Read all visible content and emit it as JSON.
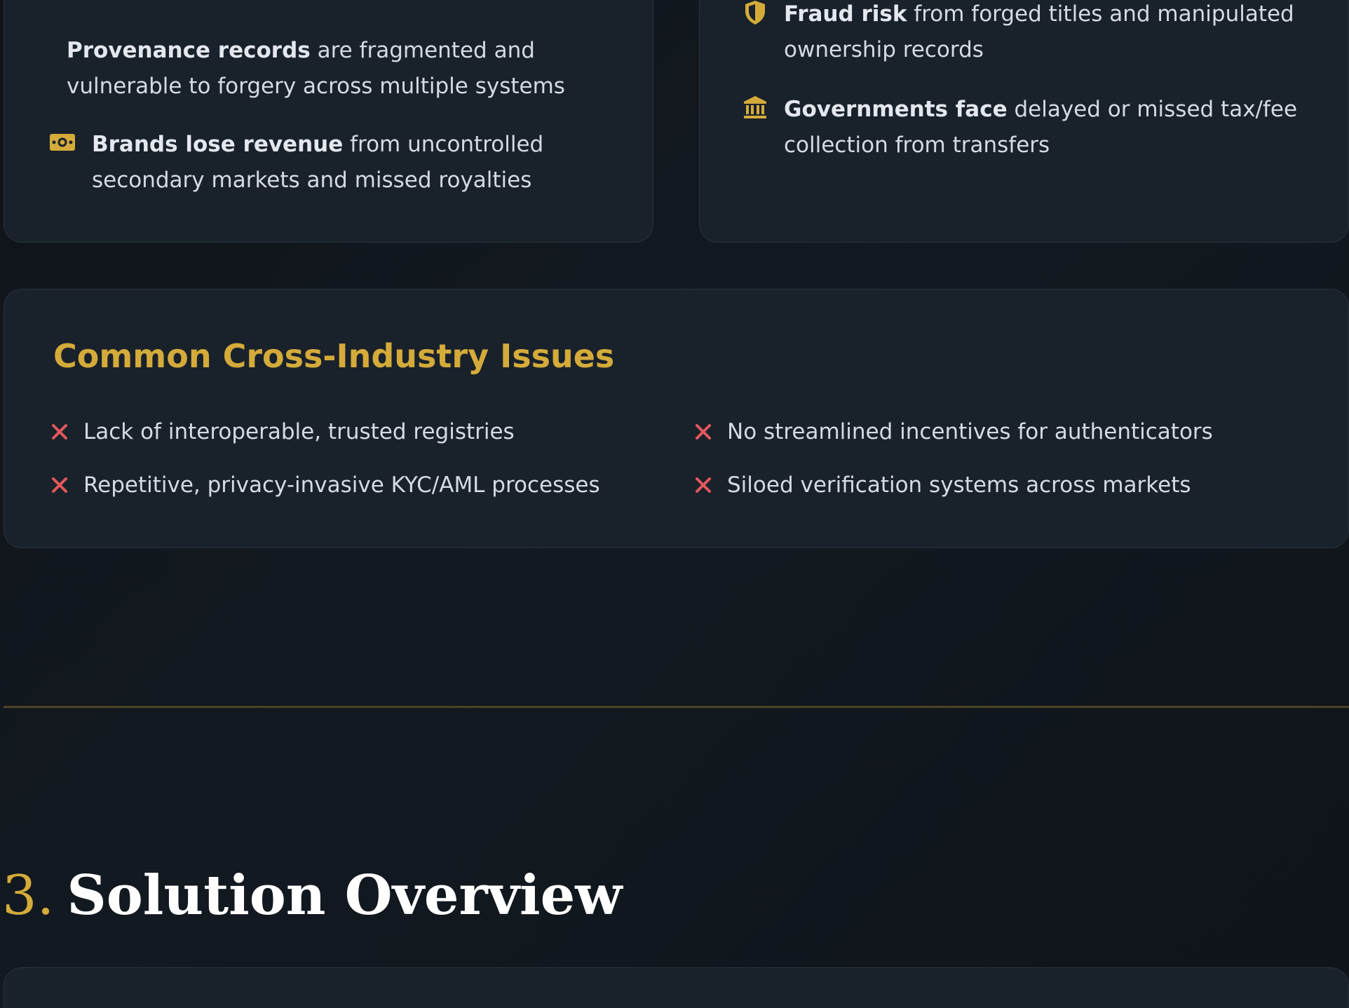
{
  "colors": {
    "accent": "#d4ab3a",
    "issue_x": "#e2585c",
    "card_bg": "#19212a",
    "page_bg": "#10141a"
  },
  "left_card": {
    "provenance": {
      "bold": "Provenance records",
      "line1_rest": " are fragmented and",
      "line2": "vulnerable to forgery across multiple systems"
    },
    "brands": {
      "icon": "money-bill-icon",
      "bold": "Brands lose revenue",
      "line1_rest": " from uncontrolled",
      "line2": "secondary markets and missed royalties"
    }
  },
  "right_card": {
    "fraud": {
      "icon": "shield-icon",
      "bold": "Fraud risk",
      "line1_rest": " from forged titles and manipulated",
      "line2": "ownership records"
    },
    "governments": {
      "icon": "bank-icon",
      "bold": "Governments face",
      "line1_rest": " delayed or missed tax/fee",
      "line2": "collection from transfers"
    }
  },
  "issues": {
    "heading": "Common Cross-Industry Issues",
    "items": [
      "Lack of interoperable, trusted registries",
      "No streamlined incentives for authenticators",
      "Repetitive, privacy-invasive KYC/AML processes",
      "Siloed verification systems across markets"
    ]
  },
  "section": {
    "number": "3.",
    "title": "Solution Overview"
  }
}
